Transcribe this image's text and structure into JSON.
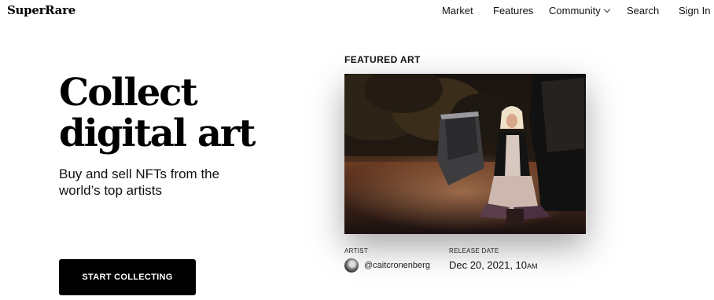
{
  "header": {
    "logo": "SuperRare",
    "nav": {
      "market": "Market",
      "features": "Features",
      "community": "Community",
      "search": "Search",
      "sign_in": "Sign In"
    }
  },
  "hero": {
    "title_line1": "Collect",
    "title_line2": "digital art",
    "subtitle": "Buy and sell NFTs from the world’s top artists",
    "cta_label": "START COLLECTING"
  },
  "featured": {
    "section_label": "FEATURED ART",
    "artist_label": "ARTIST",
    "artist_handle": "@caitcronenberg",
    "release_label": "RELEASE DATE",
    "release_date": "Dec 20, 2021, 10",
    "release_suffix": "AM"
  },
  "icons": {
    "community_dropdown": "chevron-down-icon",
    "avatar": "artist-avatar"
  }
}
